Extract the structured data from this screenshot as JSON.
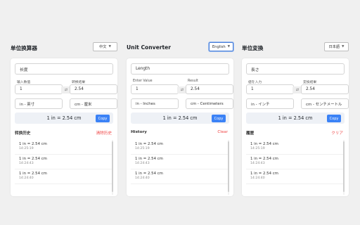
{
  "colors": {
    "accent": "#3b82f6",
    "danger": "#ef4444",
    "background": "#f0f0f0"
  },
  "panels": [
    {
      "title": "单位换算器",
      "language": "中文",
      "category": "长度",
      "from_label": "输入数值",
      "to_label": "转换结果",
      "from_value": "1",
      "to_value": "2.54",
      "swap_icon": "⇄",
      "from_unit": "in - 英寸",
      "to_unit": "cm - 厘米",
      "result": "1 in = 2.54 cm",
      "copy_label": "Copy",
      "history_title": "转换历史",
      "clear_label": "清除历史",
      "history": [
        {
          "value": "1 in = 2.54 cm",
          "time": "14:25:19"
        },
        {
          "value": "1 in = 2.54 cm",
          "time": "14:24:43"
        },
        {
          "value": "1 in = 2.54 cm",
          "time": "14:24:40"
        }
      ]
    },
    {
      "title": "Unit Converter",
      "language": "English",
      "category": "Length",
      "from_label": "Enter Value",
      "to_label": "Result",
      "from_value": "1",
      "to_value": "2.54",
      "swap_icon": "⇄",
      "from_unit": "in - Inches",
      "to_unit": "cm - Centimeters",
      "result": "1 in = 2.54 cm",
      "copy_label": "Copy",
      "history_title": "History",
      "clear_label": "Clear",
      "history": [
        {
          "value": "1 in = 2.54 cm",
          "time": "14:25:19"
        },
        {
          "value": "1 in = 2.54 cm",
          "time": "14:24:43"
        },
        {
          "value": "1 in = 2.54 cm",
          "time": "14:24:40"
        }
      ]
    },
    {
      "title": "単位変換",
      "language": "日本語",
      "category": "長さ",
      "from_label": "値を入力",
      "to_label": "変換結果",
      "from_value": "1",
      "to_value": "2.54",
      "swap_icon": "⇄",
      "from_unit": "in - インチ",
      "to_unit": "cm - センチメートル",
      "result": "1 in = 2.54 cm",
      "copy_label": "Copy",
      "history_title": "履歴",
      "clear_label": "クリア",
      "history": [
        {
          "value": "1 in = 2.54 cm",
          "time": "14:25:19"
        },
        {
          "value": "1 in = 2.54 cm",
          "time": "14:24:43"
        },
        {
          "value": "1 in = 2.54 cm",
          "time": "14:24:40"
        }
      ]
    }
  ]
}
